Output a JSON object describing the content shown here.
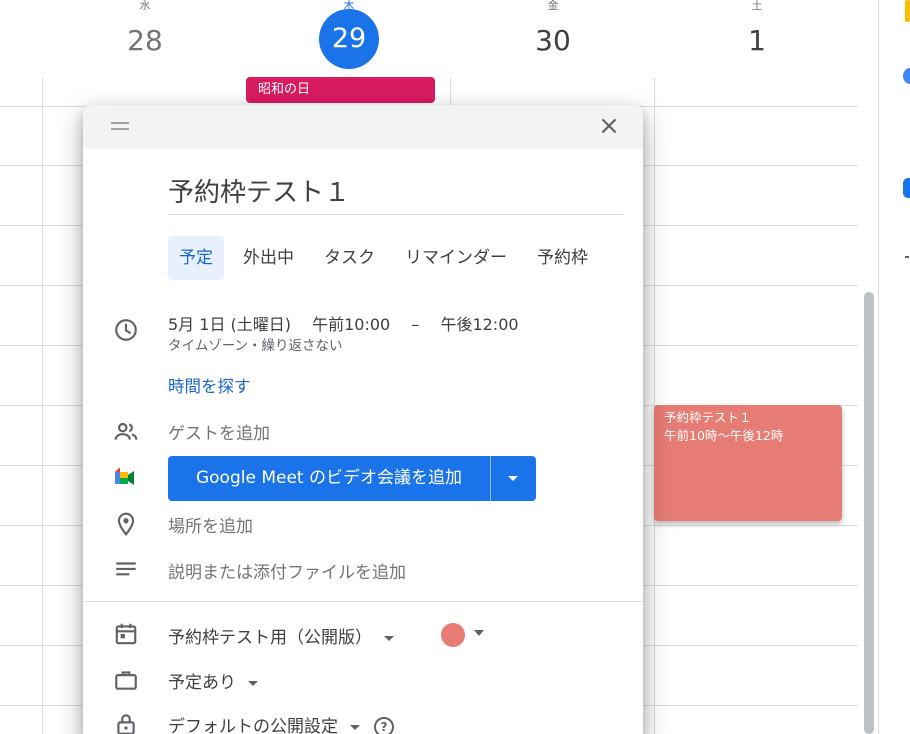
{
  "calendar": {
    "days": [
      {
        "dow": "水",
        "num": "28"
      },
      {
        "dow": "木",
        "num": "29"
      },
      {
        "dow": "金",
        "num": "30"
      },
      {
        "dow": "土",
        "num": "1"
      }
    ],
    "holiday": "昭和の日",
    "event": {
      "title": "予約枠テスト１",
      "time": "午前10時～午後12時",
      "color": "#e67c73"
    }
  },
  "dialog": {
    "close_glyph": "×",
    "title": "予約枠テスト１",
    "tabs": [
      {
        "label": "予定",
        "active": true
      },
      {
        "label": "外出中",
        "active": false
      },
      {
        "label": "タスク",
        "active": false
      },
      {
        "label": "リマインダー",
        "active": false
      },
      {
        "label": "予約枠",
        "active": false
      }
    ],
    "datetime": {
      "date": "5月 1日 (土曜日)",
      "start": "午前10:00",
      "dash": "–",
      "end": "午後12:00"
    },
    "sub": "タイムゾーン・繰り返さない",
    "find_time": "時間を探す",
    "guests": "ゲストを追加",
    "meet_button": "Google Meet のビデオ会議を追加",
    "location": "場所を追加",
    "description": "説明または添付ファイルを追加",
    "calendar_name": "予約枠テスト用（公開版）",
    "event_color": "#e67c73",
    "availability": "予定あり",
    "visibility": "デフォルトの公開設定",
    "help_glyph": "?"
  },
  "icons": {
    "clock": "clock-icon",
    "guests": "people-icon",
    "meet": "google-meet-icon",
    "location": "location-pin-icon",
    "description": "notes-icon",
    "calendar": "calendar-icon",
    "availability": "briefcase-icon",
    "visibility": "lock-icon"
  }
}
